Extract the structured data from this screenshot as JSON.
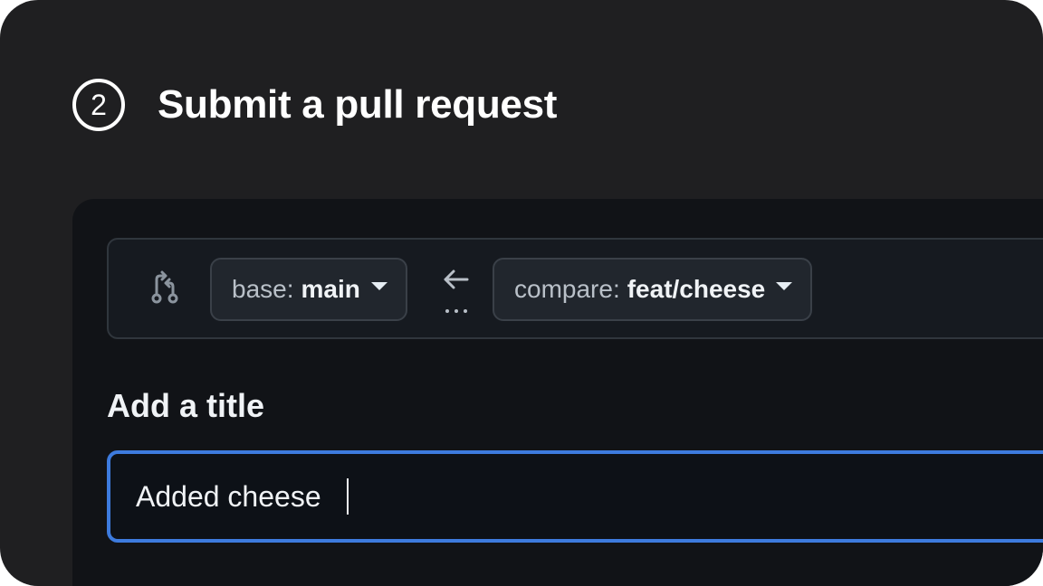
{
  "step": {
    "number": "2",
    "title": "Submit a pull request"
  },
  "compare_bar": {
    "icon": "git-compare-icon",
    "base": {
      "key": "base:",
      "value": "main"
    },
    "compare": {
      "key": "compare:",
      "value": "feat/cheese"
    },
    "direction_icon": "arrow-left-icon"
  },
  "title_section": {
    "label": "Add a title",
    "input_value": "Added cheese"
  },
  "colors": {
    "card_bg": "#1f1f21",
    "panel_bg": "#111317",
    "focus_border": "#3d7bde",
    "text": "#f0f3f6"
  }
}
